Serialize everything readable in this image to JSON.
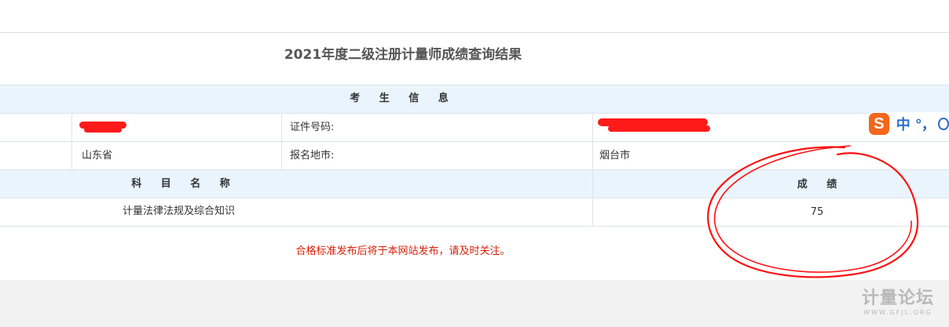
{
  "page": {
    "title": "2021年度二级注册计量师成绩查询结果"
  },
  "candidate": {
    "header": "考 生 信 息",
    "id_label": "证件号码:",
    "province": "山东省",
    "city_label": "报名地市:",
    "city": "烟台市"
  },
  "scores": {
    "subject_header": "科 目 名 称",
    "score_header": "成 绩",
    "rows": [
      {
        "subject": "计量法律法规及综合知识",
        "score": "75"
      }
    ]
  },
  "notice": "合格标准发布后将于本网站发布，请及时关注。",
  "ime": {
    "logo": "S",
    "mode": "中",
    "punct": "°，",
    "icon": "more-icon"
  },
  "watermark": {
    "title": "计量论坛",
    "url": "WWW.GFJL.ORG"
  },
  "colors": {
    "header_band": "#eaf4fd",
    "notice": "#d81e06",
    "annotation": "#ff1010"
  }
}
